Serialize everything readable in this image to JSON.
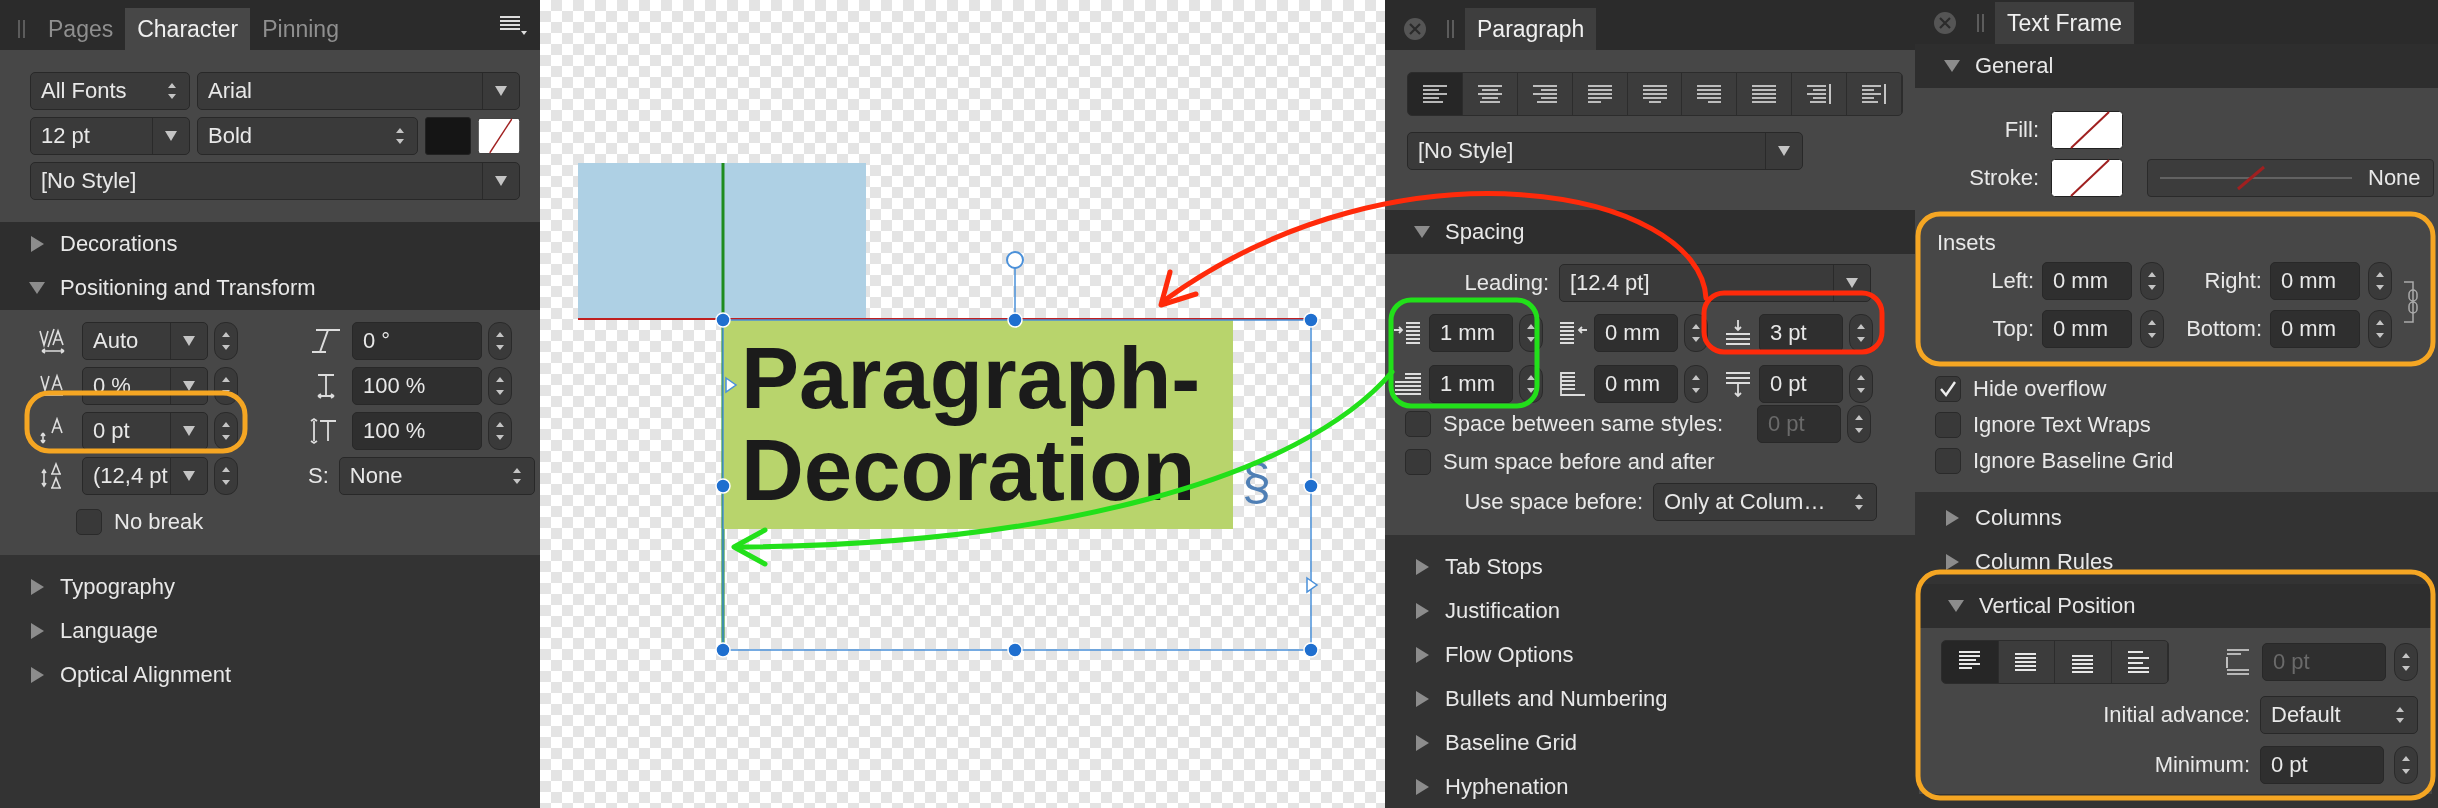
{
  "character_panel": {
    "tabs": [
      {
        "label": "Pages",
        "selected": false
      },
      {
        "label": "Character",
        "selected": true
      },
      {
        "label": "Pinning",
        "selected": false
      }
    ],
    "font_collection": "All Fonts",
    "font_family": "Arial",
    "font_size": "12 pt",
    "font_style": "Bold",
    "style": "[No Style]",
    "sections": [
      {
        "label": "Decorations",
        "expanded": false
      },
      {
        "label": "Positioning and Transform",
        "expanded": true
      }
    ],
    "positioning": [
      {
        "kind": "combo",
        "value": "Auto"
      },
      {
        "kind": "spin",
        "value": "0 °"
      },
      {
        "kind": "combo",
        "value": "0 %"
      },
      {
        "kind": "spin",
        "value": "100 %"
      },
      {
        "kind": "combo",
        "value": "0 pt"
      },
      {
        "kind": "spin",
        "value": "100 %"
      },
      {
        "kind": "combo",
        "value": "(12,4 pt"
      },
      {
        "kind": "popup",
        "label": "S:",
        "value": "None"
      }
    ],
    "no_break": {
      "label": "No break",
      "checked": false
    },
    "more_sections": [
      {
        "label": "Typography",
        "expanded": false
      },
      {
        "label": "Language",
        "expanded": false
      },
      {
        "label": "Optical Alignment",
        "expanded": false
      }
    ]
  },
  "canvas": {
    "text_lines": [
      "Paragraph-",
      "Decoration"
    ],
    "end_mark": "§"
  },
  "paragraph_panel": {
    "tab": {
      "label": "Paragraph",
      "selected": true
    },
    "alignment_buttons": [
      {
        "selected": true
      },
      {
        "selected": false
      },
      {
        "selected": false
      },
      {
        "selected": false
      },
      {
        "selected": false
      },
      {
        "selected": false
      },
      {
        "selected": false
      },
      {
        "selected": false
      },
      {
        "selected": false
      }
    ],
    "style": "[No Style]",
    "spacing": {
      "label": "Spacing",
      "expanded": true
    },
    "leading_label": "Leading:",
    "leading_value": "[12.4 pt]",
    "indents": [
      {
        "value": "1 mm"
      },
      {
        "value": "0 mm"
      },
      {
        "value": "3 pt"
      },
      {
        "value": "1 mm"
      },
      {
        "value": "0 mm"
      },
      {
        "value": "0 pt"
      }
    ],
    "options": [
      {
        "label": "Space between same styles:",
        "checked": false,
        "value": "0 pt",
        "disabled": true
      },
      {
        "label": "Sum space before and after",
        "checked": false
      }
    ],
    "use_space_before_label": "Use space before:",
    "use_space_before": "Only at Colum…",
    "sections": [
      {
        "label": "Tab Stops",
        "expanded": false
      },
      {
        "label": "Justification",
        "expanded": false
      },
      {
        "label": "Flow Options",
        "expanded": false
      },
      {
        "label": "Bullets and Numbering",
        "expanded": false
      },
      {
        "label": "Baseline Grid",
        "expanded": false
      },
      {
        "label": "Hyphenation",
        "expanded": false
      }
    ]
  },
  "text_frame_panel": {
    "tab": {
      "label": "Text Frame",
      "selected": true
    },
    "general": {
      "label": "General",
      "expanded": true
    },
    "fill_label": "Fill:",
    "stroke_label": "Stroke:",
    "stroke_style": "None",
    "insets_label": "Insets",
    "insets": [
      {
        "label": "Left:",
        "value": "0 mm"
      },
      {
        "label": "Right:",
        "value": "0 mm"
      },
      {
        "label": "Top:",
        "value": "0 mm"
      },
      {
        "label": "Bottom:",
        "value": "0 mm"
      }
    ],
    "options": [
      {
        "label": "Hide overflow",
        "checked": true
      },
      {
        "label": "Ignore Text Wraps",
        "checked": false
      },
      {
        "label": "Ignore Baseline Grid",
        "checked": false
      }
    ],
    "sections": [
      {
        "label": "Columns",
        "expanded": false
      },
      {
        "label": "Column Rules",
        "expanded": false
      }
    ],
    "vertical_position": {
      "label": "Vertical Position",
      "expanded": true,
      "align_buttons": [
        {
          "selected": true
        },
        {
          "selected": false
        },
        {
          "selected": false
        },
        {
          "selected": false
        }
      ],
      "spacing_value": "0 pt",
      "spacing_disabled": true,
      "initial_advance_label": "Initial advance:",
      "initial_advance": "Default",
      "minimum_label": "Minimum:",
      "minimum": "0 pt"
    }
  }
}
